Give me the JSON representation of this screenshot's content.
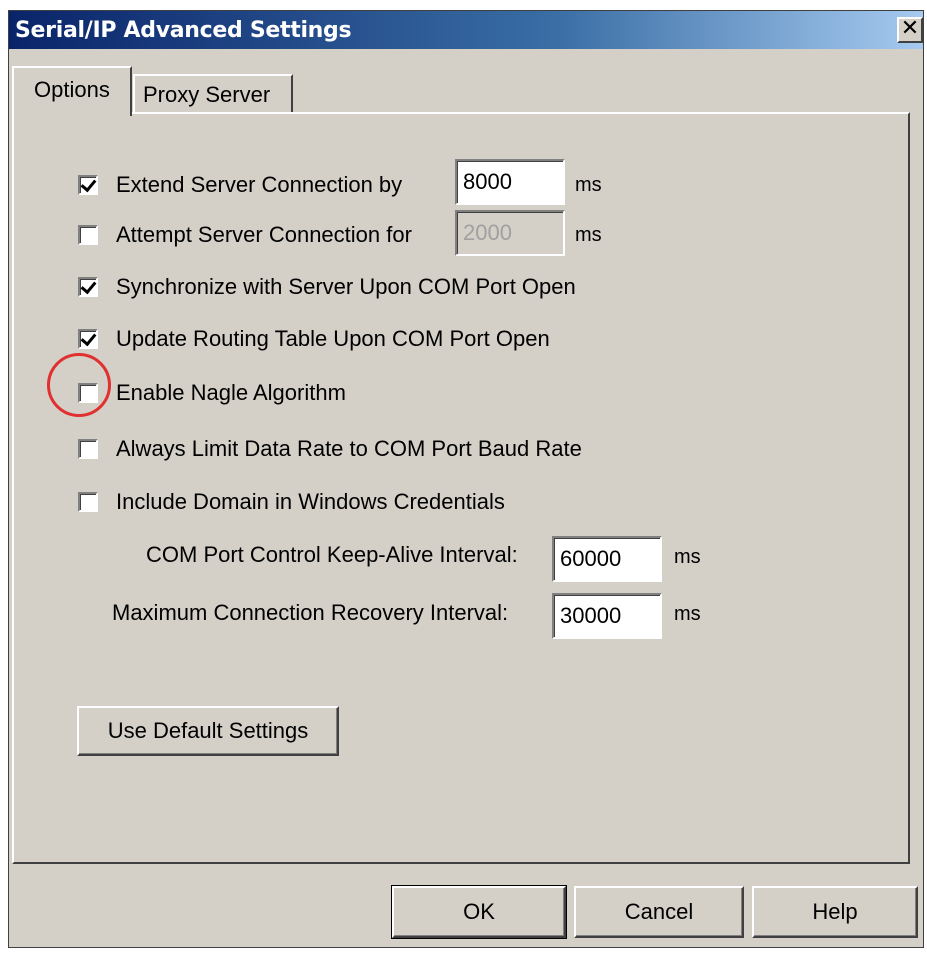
{
  "window": {
    "title": "Serial/IP Advanced Settings",
    "close_glyph": "✕"
  },
  "tabs": [
    {
      "label": "Options",
      "active": true
    },
    {
      "label": "Proxy Server",
      "active": false
    }
  ],
  "options": {
    "extend_connection": {
      "label": "Extend Server Connection by",
      "checked": true,
      "value": "8000",
      "unit": "ms"
    },
    "attempt_connection": {
      "label": "Attempt Server Connection for",
      "checked": false,
      "value": "2000",
      "unit": "ms",
      "disabled": true
    },
    "synchronize": {
      "label": "Synchronize with Server Upon COM Port Open",
      "checked": true
    },
    "update_routing": {
      "label": "Update Routing Table Upon COM Port Open",
      "checked": true
    },
    "nagle": {
      "label": "Enable Nagle Algorithm",
      "checked": false,
      "highlighted": true
    },
    "limit_rate": {
      "label": "Always Limit Data Rate to COM Port Baud Rate",
      "checked": false
    },
    "include_domain": {
      "label": "Include Domain in Windows Credentials",
      "checked": false
    },
    "keepalive": {
      "label": "COM Port Control Keep-Alive Interval:",
      "value": "60000",
      "unit": "ms"
    },
    "recovery": {
      "label": "Maximum Connection Recovery Interval:",
      "value": "30000",
      "unit": "ms"
    }
  },
  "buttons": {
    "default_settings": "Use Default Settings",
    "ok": "OK",
    "cancel": "Cancel",
    "help": "Help"
  },
  "colors": {
    "titlebar_start": "#0a246a",
    "titlebar_end": "#a6caf0",
    "dialog_face": "#d4d0c8",
    "highlight_circle": "#e03030"
  }
}
